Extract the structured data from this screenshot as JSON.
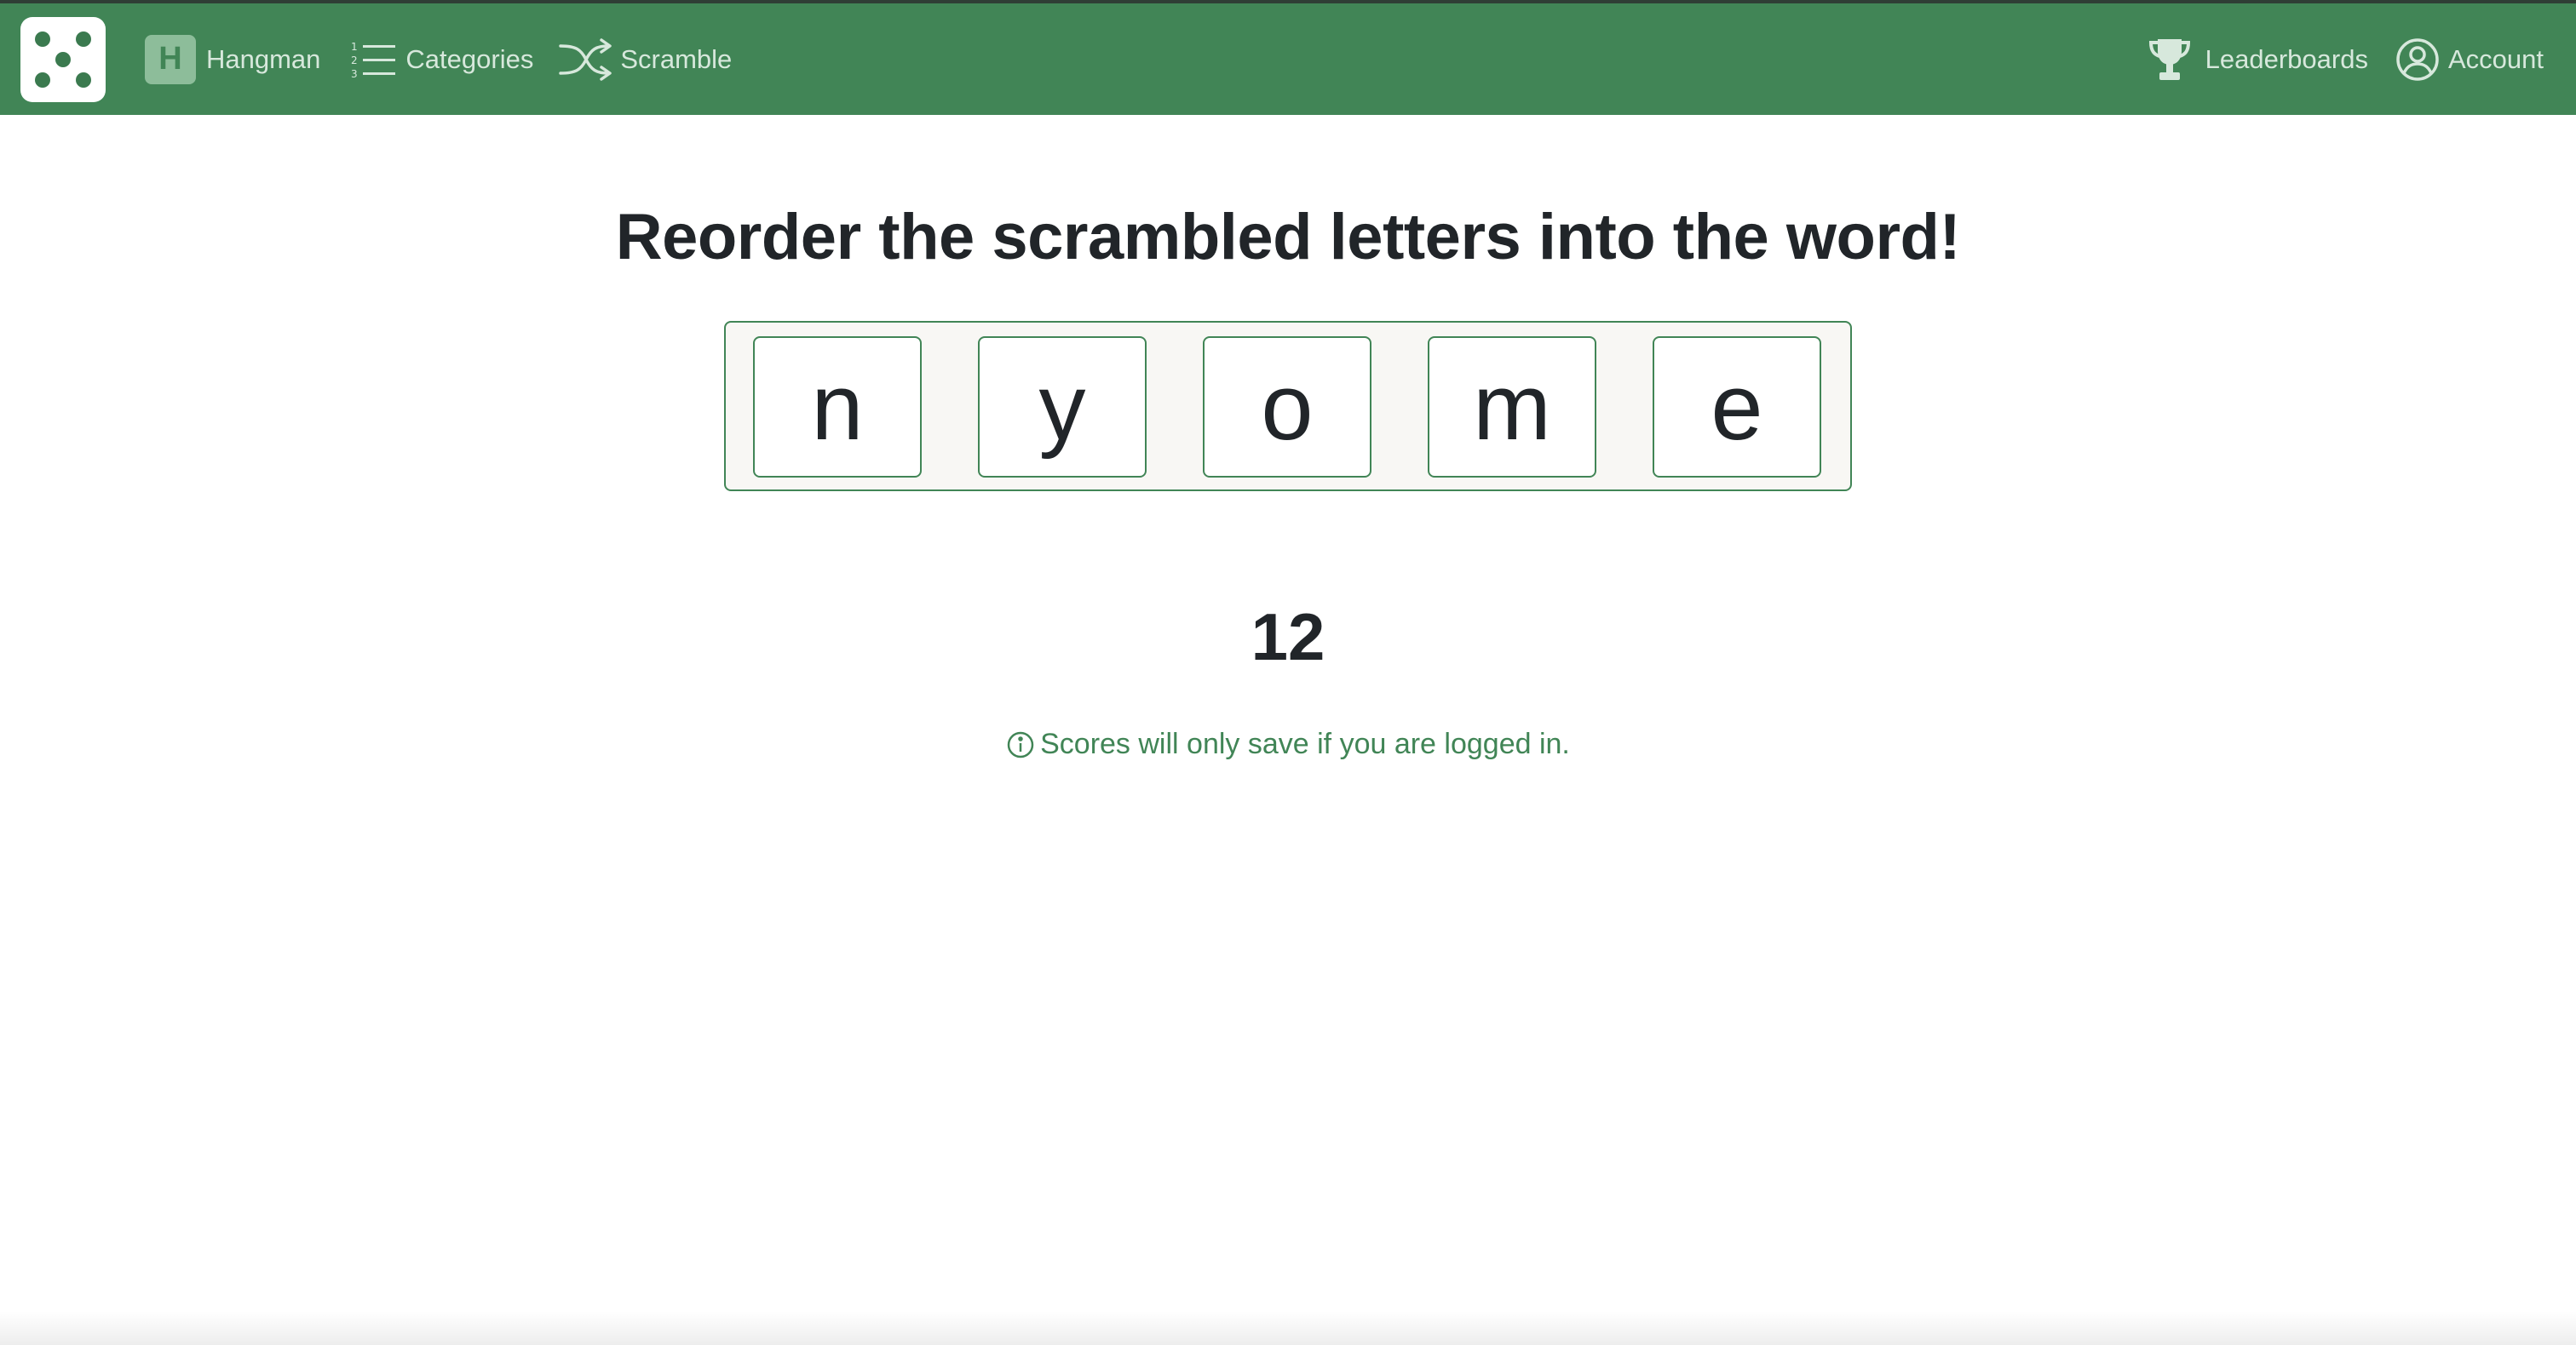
{
  "colors": {
    "brand_green": "#418556",
    "nav_text": "#d7e8dc",
    "tray_bg": "#f8f7f4",
    "text_dark": "#212529"
  },
  "nav": {
    "logo_icon": "dice-five-icon",
    "links_left": [
      {
        "label": "Hangman",
        "icon": "h-badge-icon"
      },
      {
        "label": "Categories",
        "icon": "numbered-list-icon"
      },
      {
        "label": "Scramble",
        "icon": "shuffle-icon"
      }
    ],
    "links_right": [
      {
        "label": "Leaderboards",
        "icon": "trophy-icon"
      },
      {
        "label": "Account",
        "icon": "user-circle-icon"
      }
    ],
    "hangman_badge_letter": "H"
  },
  "game": {
    "title": "Reorder the scrambled letters into the word!",
    "letters": [
      "n",
      "y",
      "o",
      "m",
      "e"
    ],
    "score": "12",
    "notice": "Scores will only save if you are logged in.",
    "notice_icon": "info-circle-icon"
  }
}
